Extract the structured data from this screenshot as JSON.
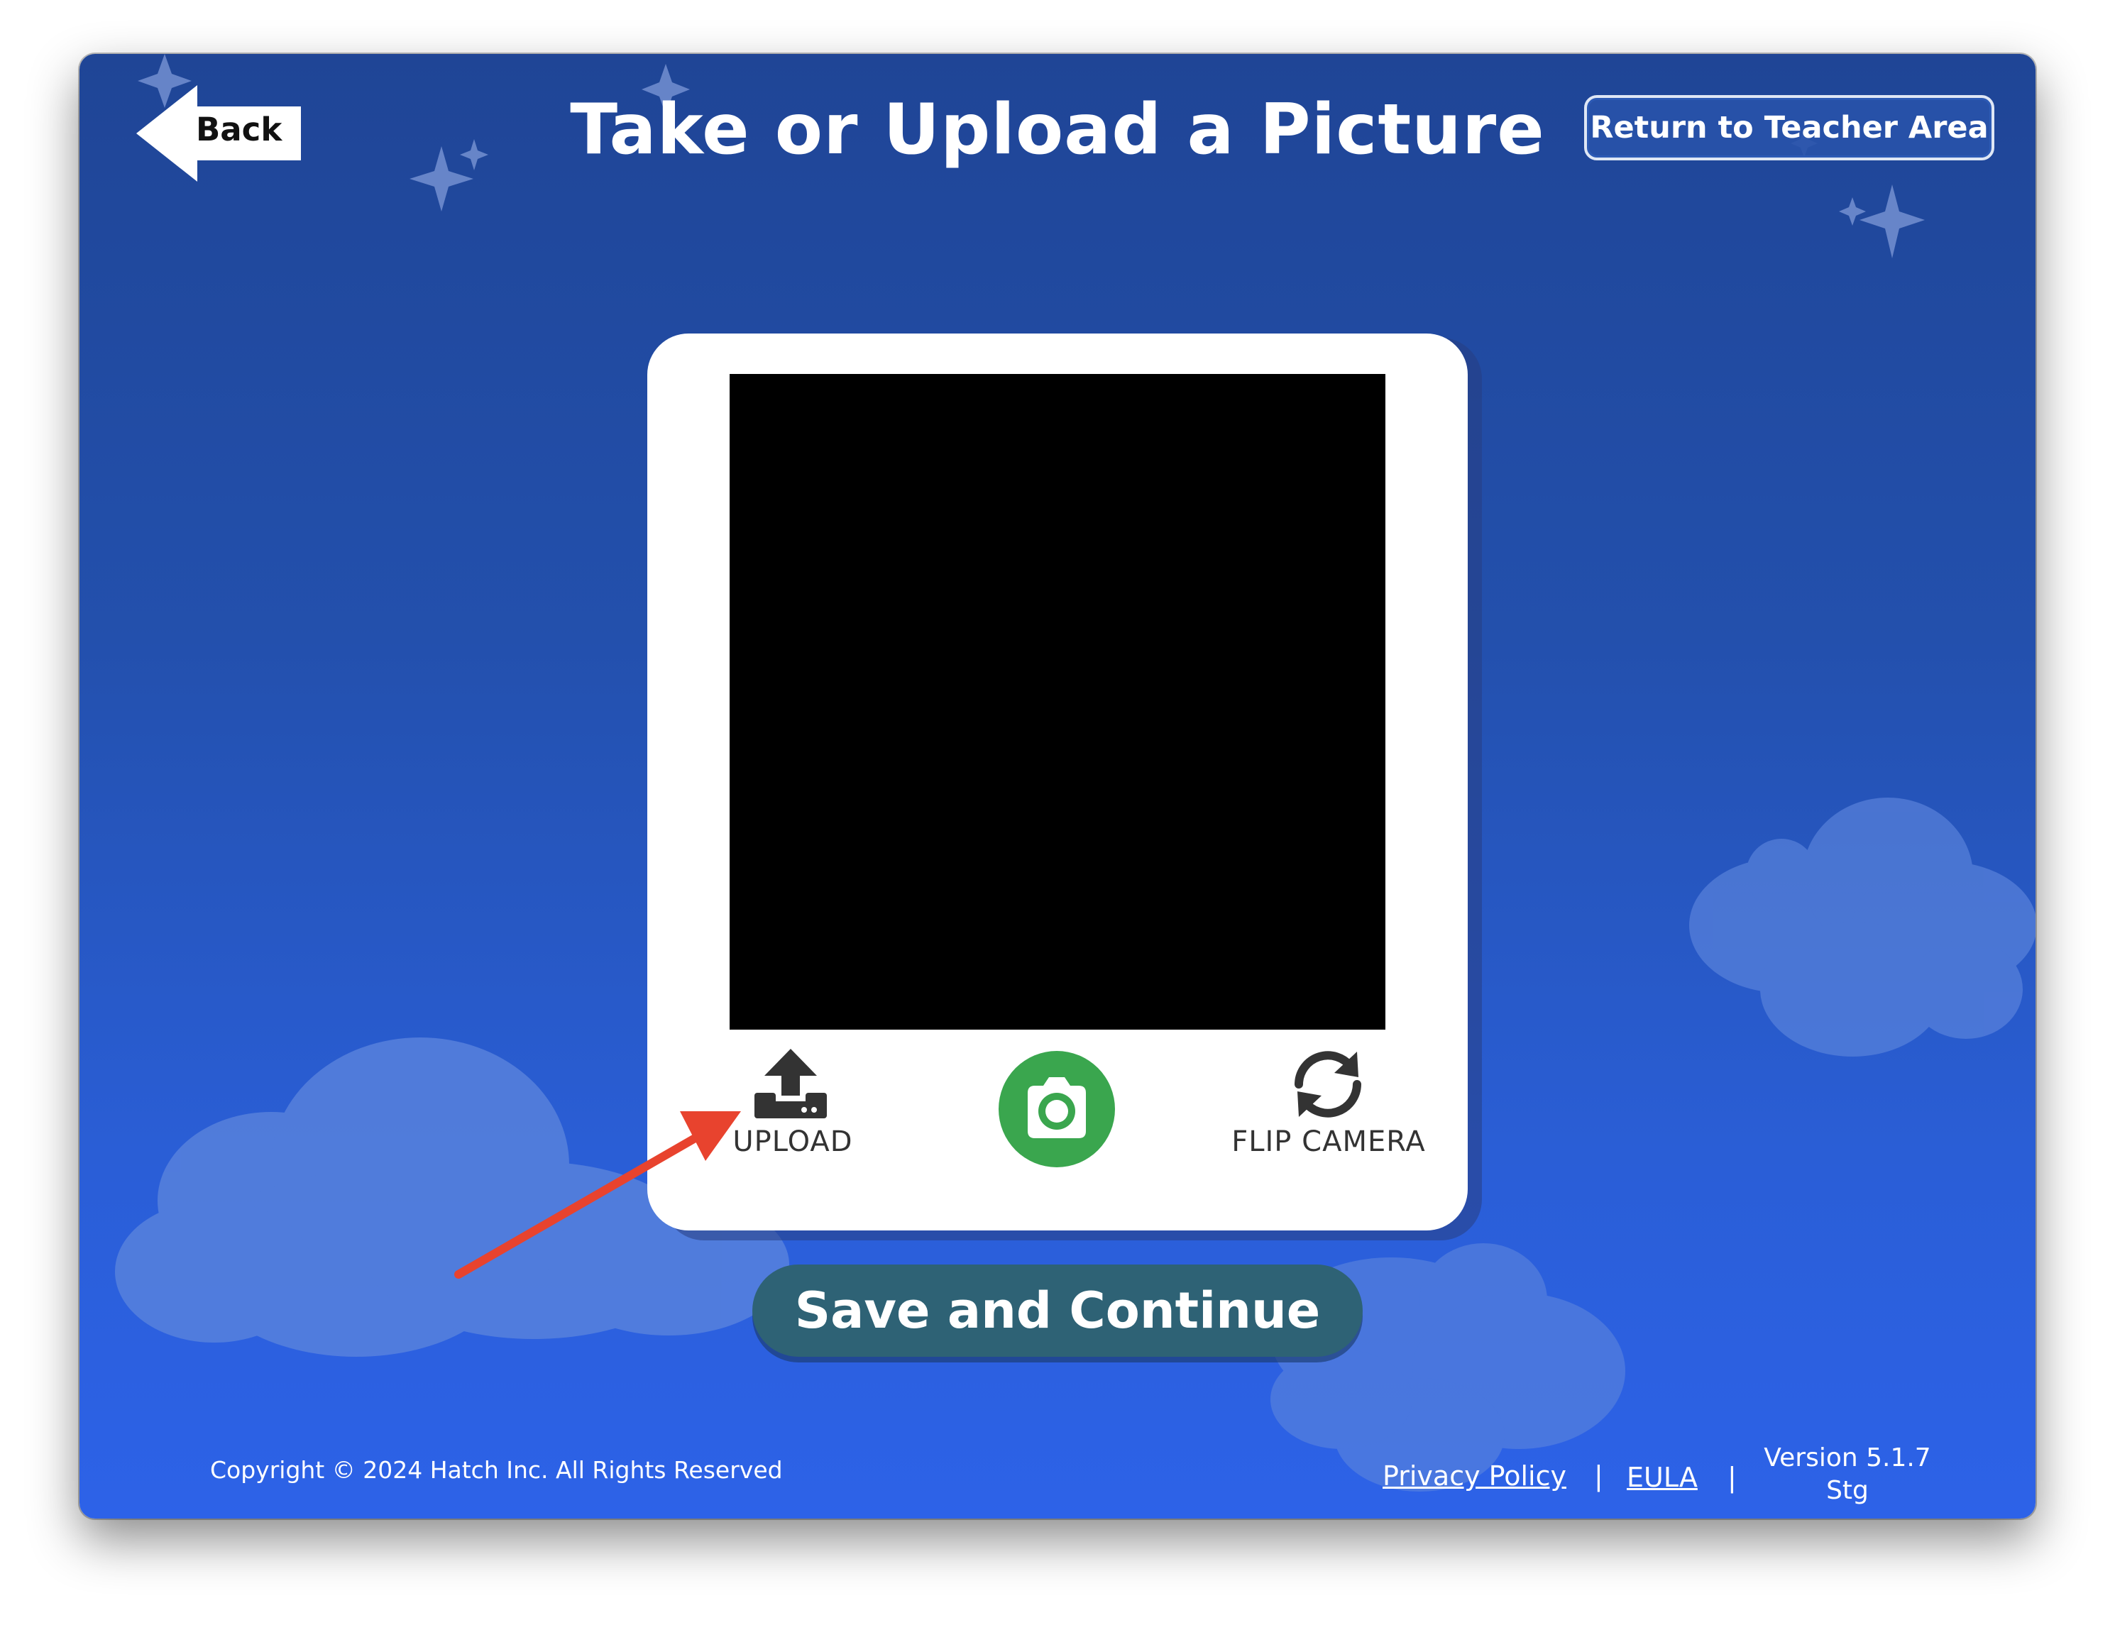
{
  "header": {
    "back_label": "Back",
    "title": "Take or Upload a Picture",
    "teacher_area_label": "Return to Teacher Area"
  },
  "camera_card": {
    "upload_label": "UPLOAD",
    "shutter_icon": "camera-icon",
    "flip_label": "FLIP CAMERA"
  },
  "actions": {
    "save_label": "Save and Continue"
  },
  "footer": {
    "copyright": "Copyright © 2024 Hatch Inc. All Rights Reserved",
    "privacy_label": "Privacy Policy",
    "separator": "|",
    "eula_label": "EULA",
    "version_line1": "Version 5.1.7",
    "version_line2": "Stg"
  },
  "colors": {
    "background_top": "#1f4596",
    "background_bottom": "#2d62e8",
    "shutter_green": "#3aa64e",
    "save_button": "#2e6275",
    "annotation_arrow": "#e8432e"
  }
}
